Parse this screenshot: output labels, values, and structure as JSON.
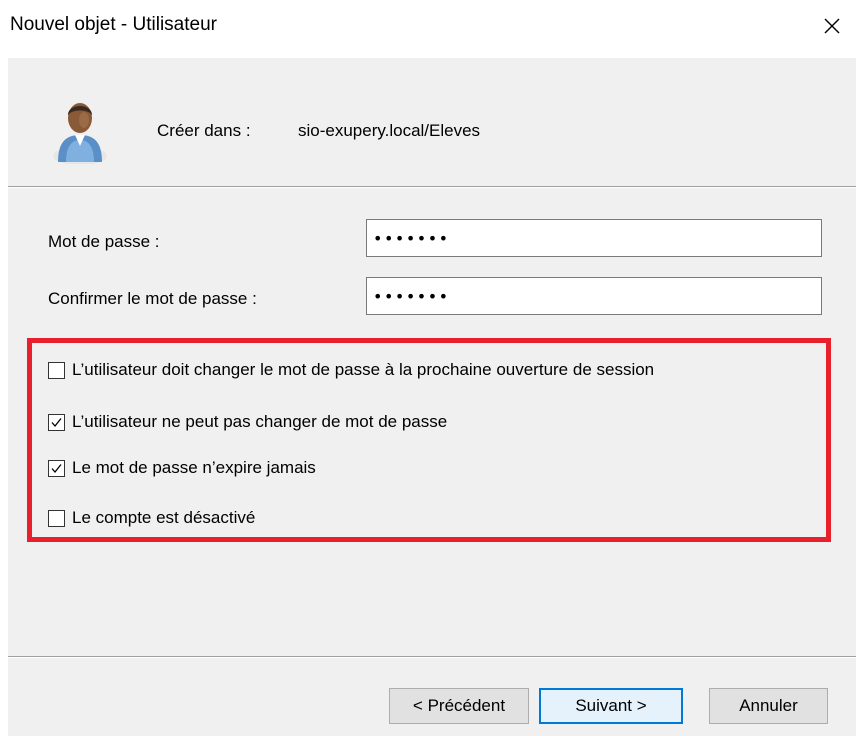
{
  "window": {
    "title": "Nouvel objet - Utilisateur",
    "close_icon": "close-icon"
  },
  "header": {
    "icon": "user-icon",
    "create_in_label": "Créer dans :",
    "create_in_path": "sio-exupery.local/Eleves"
  },
  "form": {
    "password": {
      "label": "Mot de passe :",
      "value": "•••••••"
    },
    "confirm_password": {
      "label": "Confirmer le mot de passe :",
      "value": "•••••••"
    }
  },
  "options": [
    {
      "label": "L’utilisateur doit changer le mot de passe à la prochaine ouverture de session",
      "checked": false
    },
    {
      "label": "L’utilisateur ne peut pas changer de mot de passe",
      "checked": true
    },
    {
      "label": "Le mot de passe n’expire jamais",
      "checked": true
    },
    {
      "label": "Le compte est désactivé",
      "checked": false
    }
  ],
  "highlight_color": "#e8202c",
  "buttons": {
    "previous": "< Précédent",
    "next": "Suivant >",
    "cancel": "Annuler"
  }
}
